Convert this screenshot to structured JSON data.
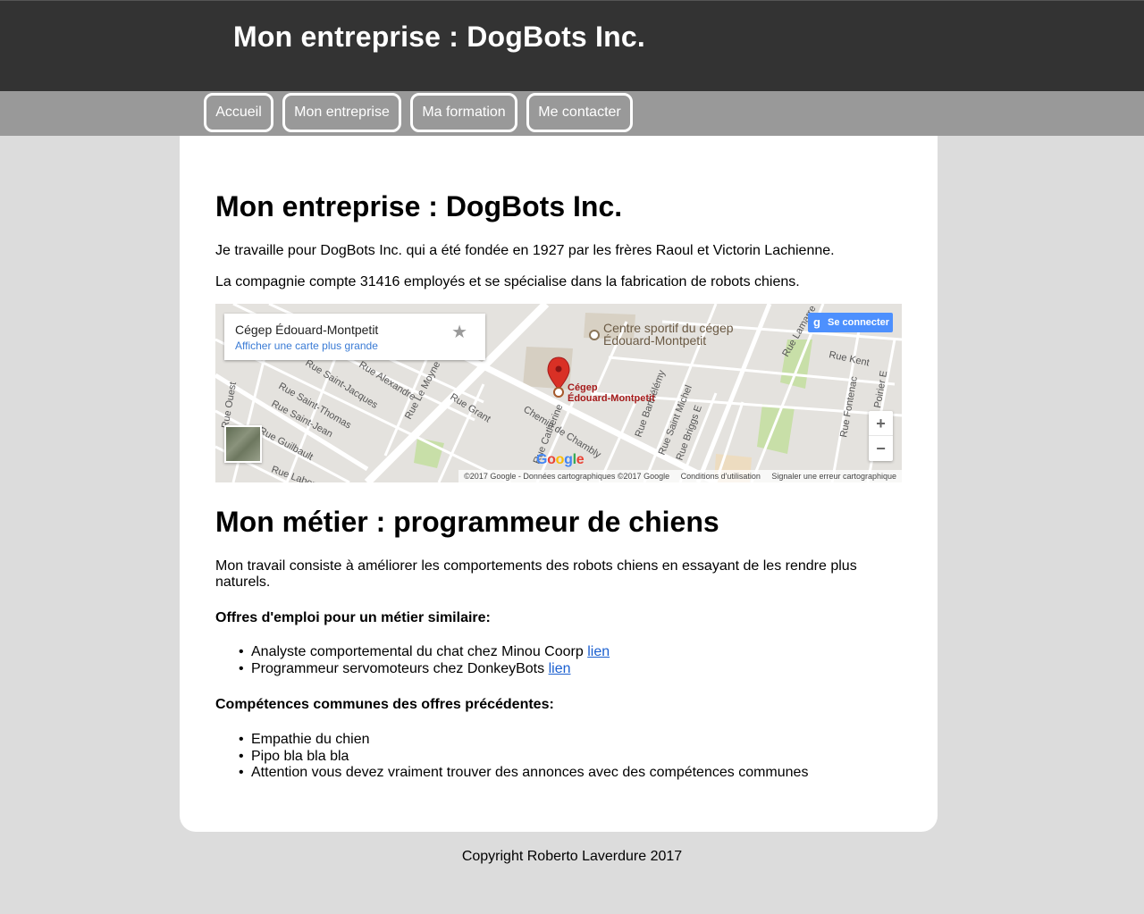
{
  "header": {
    "title": "Mon entreprise : DogBots Inc."
  },
  "nav": {
    "items": [
      {
        "label": "Accueil"
      },
      {
        "label": "Mon entreprise"
      },
      {
        "label": "Ma formation"
      },
      {
        "label": "Me contacter"
      }
    ]
  },
  "main": {
    "heading1": "Mon entreprise : DogBots Inc.",
    "intro1": "Je travaille pour DogBots Inc. qui a été fondée en 1927 par les frères Raoul et Victorin Lachienne.",
    "intro2": "La compagnie compte 31416 employés et se spécialise dans la fabrication de robots chiens.",
    "map": {
      "place_name": "Cégep Édouard-Montpetit",
      "larger_map_link": "Afficher une carte plus grande",
      "star": "★",
      "sign_in": "Se connecter",
      "sign_in_icon": "g",
      "zoom_in": "+",
      "zoom_out": "−",
      "pin_label_line1": "Cégep",
      "pin_label_line2": "Édouard-Montpetit",
      "poi_line1": "Centre sportif du cégep",
      "poi_line2": "Édouard-Montpetit",
      "google_logo": "Google",
      "copyright": "©2017 Google - Données cartographiques ©2017 Google",
      "terms": "Conditions d'utilisation",
      "report": "Signaler une erreur cartographique",
      "street_labels": [
        "Rue Saint-Jacques",
        "Rue Saint-Thomas",
        "Rue Saint-Jean",
        "Rue Guilbault",
        "Rue Grant",
        "Rue Le Moyne Ouest",
        "Chemin de Chambly",
        "Rue Barthélémy",
        "Rue Saint Michel",
        "Rue Briggs E",
        "Rue Kent",
        "Rue Lamarre",
        "Rue Fontenac",
        "Rue Poirier E",
        "Rue Alexandre",
        "Rue Catherine",
        "Rue Labonté",
        "Rue Ouest"
      ]
    },
    "heading2": "Mon métier : programmeur de chiens",
    "job_desc": "Mon travail consiste à améliorer les comportements des robots chiens en essayant de les rendre plus naturels.",
    "offers_title": "Offres d'emploi pour un métier similaire:",
    "offers": [
      {
        "text": "Analyste comportemental du chat chez Minou Coorp",
        "link": "lien"
      },
      {
        "text": "Programmeur servomoteurs chez DonkeyBots",
        "link": "lien"
      }
    ],
    "skills_title": "Compétences communes des offres précédentes:",
    "skills": [
      "Empathie du chien",
      "Pipo bla bla bla",
      "Attention vous devez vraiment trouver des annonces avec des compétences communes"
    ],
    "bullet": "•"
  },
  "footer": {
    "text": "Copyright Roberto Laverdure 2017"
  },
  "colors": {
    "header_bg": "#333333",
    "nav_bg": "#999999",
    "page_bg": "#dcdcdc",
    "link": "#1a5fd0",
    "pin": "#d93025"
  }
}
